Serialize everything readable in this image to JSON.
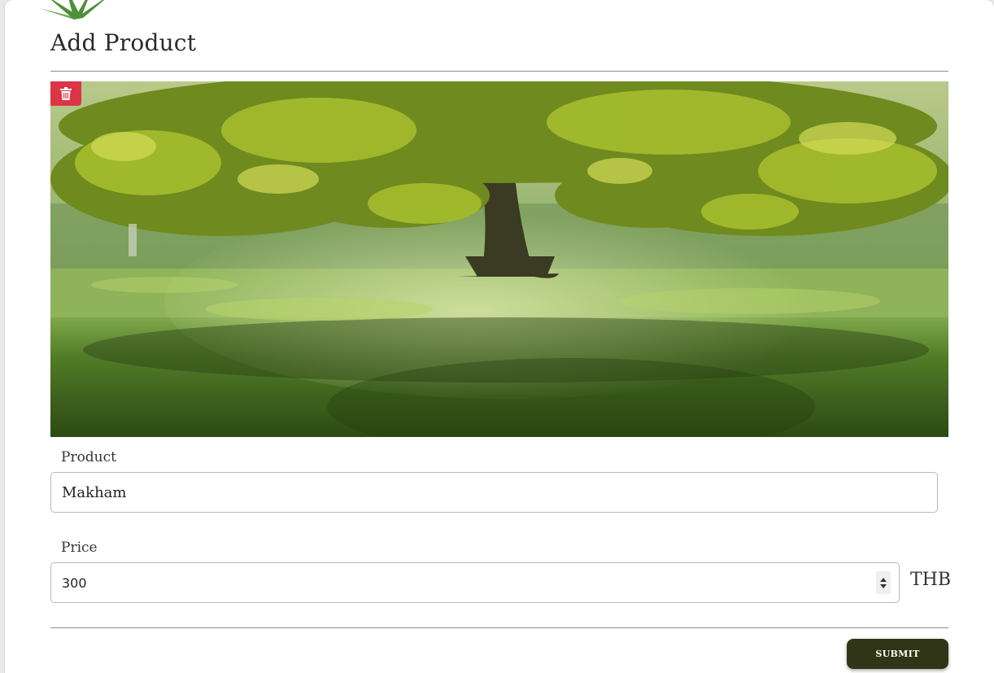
{
  "page": {
    "title": "Add Product"
  },
  "image": {
    "subject": "tree-in-meadow-photo",
    "delete_icon": "trash-icon",
    "delete_color": "#dc3545"
  },
  "form": {
    "product_label": "Product",
    "product_value": "Makham",
    "price_label": "Price",
    "price_value": "300",
    "currency": "THB",
    "submit_label": "SUBMIT"
  },
  "colors": {
    "submit_bg": "#2f3516",
    "accent_leaf": "#4f8f3a"
  }
}
